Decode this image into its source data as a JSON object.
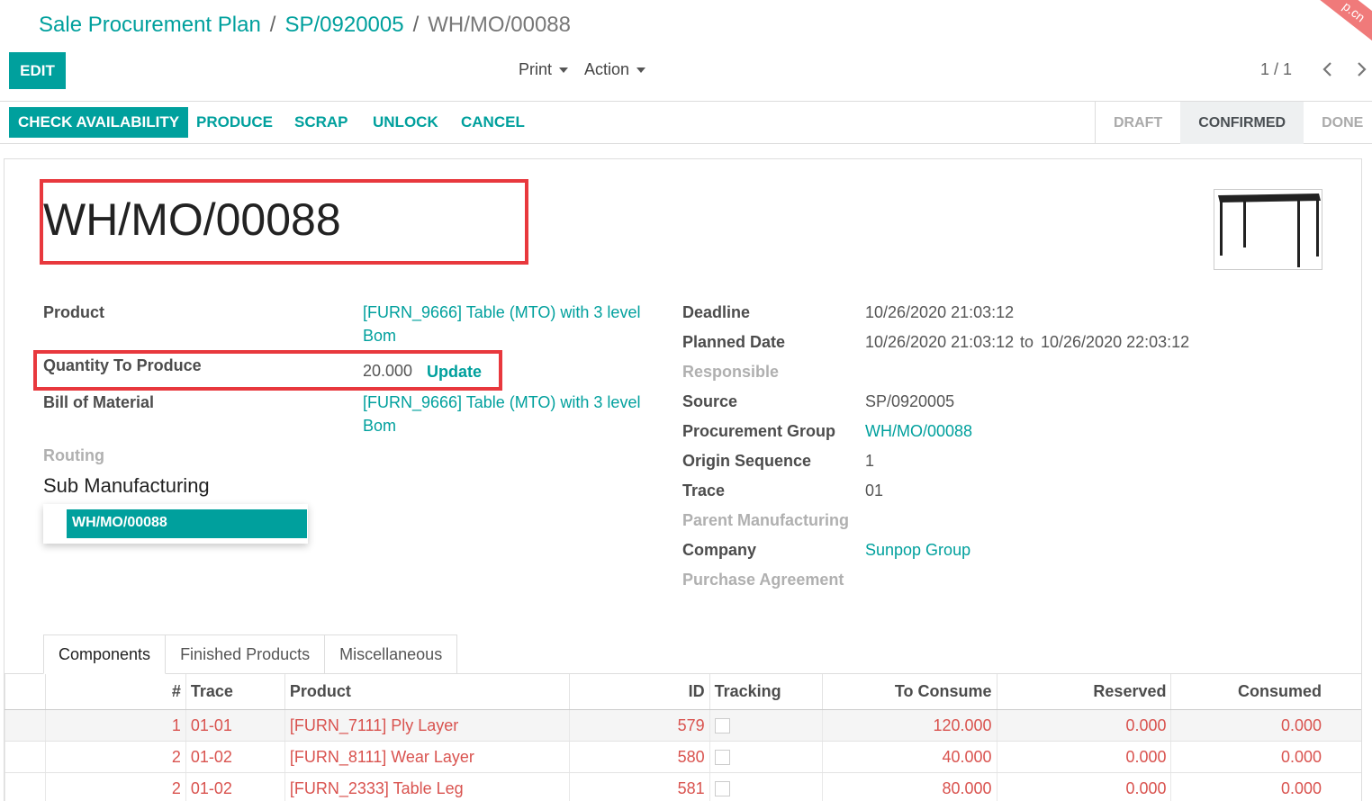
{
  "breadcrumb": {
    "items": [
      "Sale Procurement Plan",
      "SP/0920005"
    ],
    "current": "WH/MO/00088",
    "separator": "/"
  },
  "toolbar": {
    "edit_label": "EDIT",
    "print_label": "Print",
    "action_label": "Action",
    "pager": "1 / 1"
  },
  "ribbon_text": "p.cn",
  "statusbar": {
    "buttons": [
      "CHECK AVAILABILITY",
      "PRODUCE",
      "SCRAP",
      "UNLOCK",
      "CANCEL"
    ],
    "states": [
      "DRAFT",
      "CONFIRMED",
      "DONE"
    ],
    "active_state": "CONFIRMED"
  },
  "record": {
    "name": "WH/MO/00088",
    "image_icon": "table-product-image"
  },
  "fields_left": {
    "product_label": "Product",
    "product_value": "[FURN_9666] Table (MTO) with 3 level Bom",
    "qty_label": "Quantity To Produce",
    "qty_value": "20.000",
    "update_label": "Update",
    "bom_label": "Bill of Material",
    "bom_value": "[FURN_9666] Table (MTO) with 3 level Bom",
    "routing_label": "Routing"
  },
  "fields_right": {
    "deadline_label": "Deadline",
    "deadline_value": "10/26/2020 21:03:12",
    "planned_label": "Planned Date",
    "planned_from": "10/26/2020 21:03:12",
    "planned_to_word": "to",
    "planned_to": "10/26/2020 22:03:12",
    "responsible_label": "Responsible",
    "source_label": "Source",
    "source_value": "SP/0920005",
    "group_label": "Procurement Group",
    "group_value": "WH/MO/00088",
    "origin_label": "Origin Sequence",
    "origin_value": "1",
    "trace_label": "Trace",
    "trace_value": "01",
    "parent_label": "Parent Manufacturing",
    "company_label": "Company",
    "company_value": "Sunpop Group",
    "purchase_label": "Purchase Agreement"
  },
  "sub_manufacturing": {
    "title": "Sub Manufacturing",
    "items": [
      "WH/MO/00088"
    ]
  },
  "tabs": [
    "Components",
    "Finished Products",
    "Miscellaneous"
  ],
  "active_tab": "Components",
  "table": {
    "headers": [
      "#",
      "Trace",
      "Product",
      "ID",
      "Tracking",
      "To Consume",
      "Reserved",
      "Consumed"
    ],
    "rows": [
      {
        "seq": "1",
        "trace": "01-01",
        "product": "[FURN_7111] Ply Layer",
        "id": "579",
        "to_consume": "120.000",
        "reserved": "0.000",
        "consumed": "0.000"
      },
      {
        "seq": "2",
        "trace": "01-02",
        "product": "[FURN_8111] Wear Layer",
        "id": "580",
        "to_consume": "40.000",
        "reserved": "0.000",
        "consumed": "0.000"
      },
      {
        "seq": "2",
        "trace": "01-02",
        "product": "[FURN_2333] Table Leg",
        "id": "581",
        "to_consume": "80.000",
        "reserved": "0.000",
        "consumed": "0.000"
      }
    ]
  },
  "colors": {
    "accent": "#00a09d",
    "highlight_box": "#e8383d",
    "row_text": "#d9534f"
  }
}
